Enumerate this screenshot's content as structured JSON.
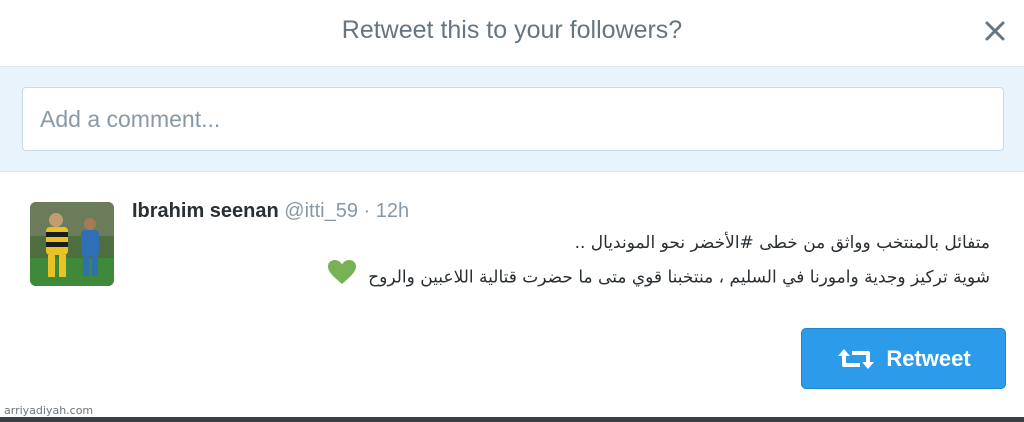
{
  "dialog": {
    "title": "Retweet this to your followers?",
    "close_icon": "close-icon"
  },
  "comment": {
    "placeholder": "Add a comment...",
    "value": ""
  },
  "tweet": {
    "fullname": "Ibrahim seenan",
    "username": "@itti_59",
    "separator": "·",
    "time": "12h",
    "text_lines": [
      "متفائل بالمنتخب وواثق من خطى #الأخضر نحو المونديال ..",
      "شوية تركيز وجدية وامورنا في السليم ، منتخبنا قوي متى ما حضرت قتالية اللاعبين والروح"
    ],
    "heart_icon": "green-heart-icon",
    "heart_color": "#77b255"
  },
  "actions": {
    "retweet_label": "Retweet",
    "retweet_icon": "retweet-icon",
    "button_color": "#2b9bea"
  },
  "footer": {
    "watermark": "arriyadiyah.com"
  }
}
